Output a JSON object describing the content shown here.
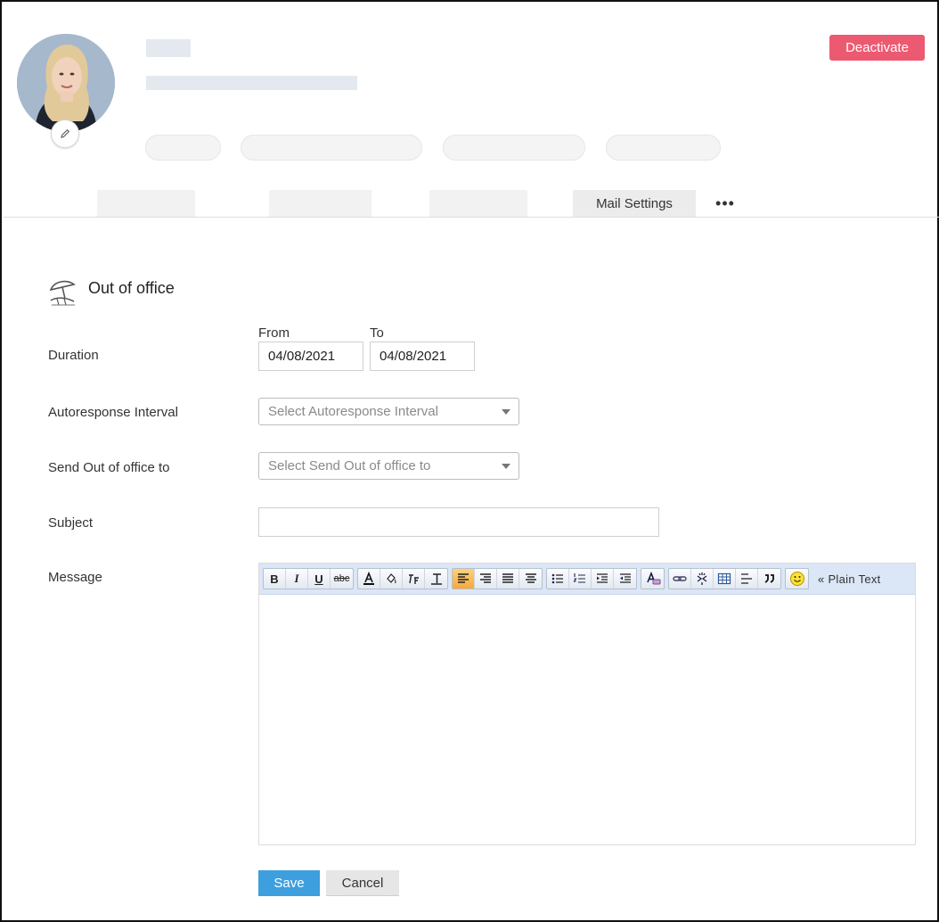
{
  "header": {
    "deactivate_label": "Deactivate"
  },
  "tabs": {
    "active_label": "Mail Settings",
    "more_label": "•••"
  },
  "section": {
    "title": "Out of office"
  },
  "form": {
    "duration_label": "Duration",
    "from_label": "From",
    "to_label": "To",
    "from_value": "04/08/2021",
    "to_value": "04/08/2021",
    "interval_label": "Autoresponse Interval",
    "interval_placeholder": "Select Autoresponse Interval",
    "send_to_label": "Send Out of office to",
    "send_to_placeholder": "Select Send Out of office to",
    "subject_label": "Subject",
    "subject_value": "",
    "message_label": "Message"
  },
  "editor": {
    "bold": "B",
    "italic": "I",
    "underline": "U",
    "strike": "abc",
    "plain_text_label": "« Plain Text"
  },
  "actions": {
    "save_label": "Save",
    "cancel_label": "Cancel"
  },
  "colors": {
    "deactivate": "#ec5a72",
    "save": "#3e9fdf",
    "toolbar": "#dbe6f6"
  }
}
